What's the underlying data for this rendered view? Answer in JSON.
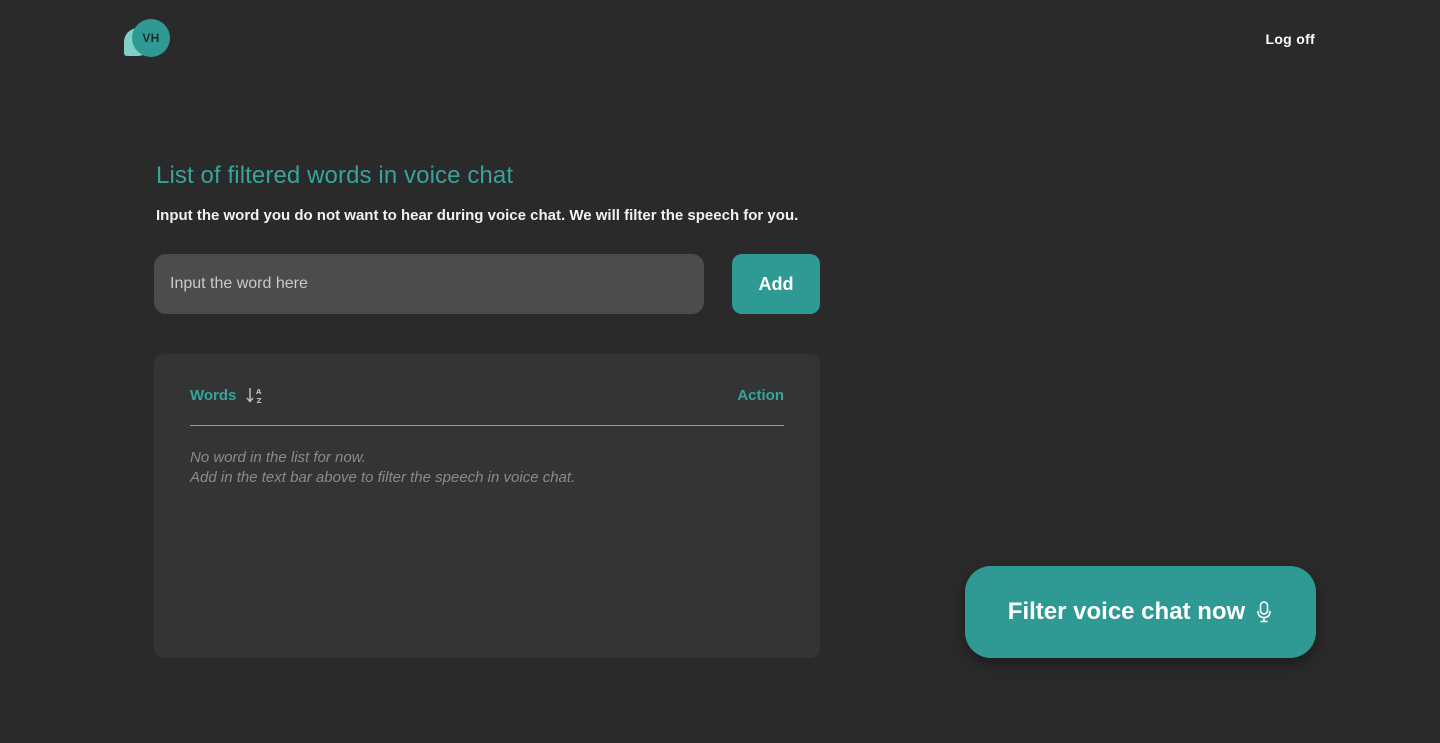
{
  "header": {
    "logo_text": "VH",
    "logoff_label": "Log off"
  },
  "main": {
    "title": "List of filtered words in voice chat",
    "subtitle": "Input the word you do not want to hear during voice chat. We will filter the speech for you.",
    "input": {
      "placeholder": "Input the word here",
      "value": ""
    },
    "add_label": "Add"
  },
  "table": {
    "col_words": "Words",
    "col_action": "Action",
    "empty_line1": "No word in the list for now.",
    "empty_line2": "Add in the text bar above to filter the speech in voice chat."
  },
  "cta": {
    "label": "Filter voice chat now"
  },
  "icons": {
    "sort": "sort-alpha-icon",
    "mic": "microphone-icon"
  },
  "colors": {
    "accent": "#2f9a94",
    "background": "#2a2a2b",
    "panel": "#333535",
    "input": "#4b4c4c"
  }
}
